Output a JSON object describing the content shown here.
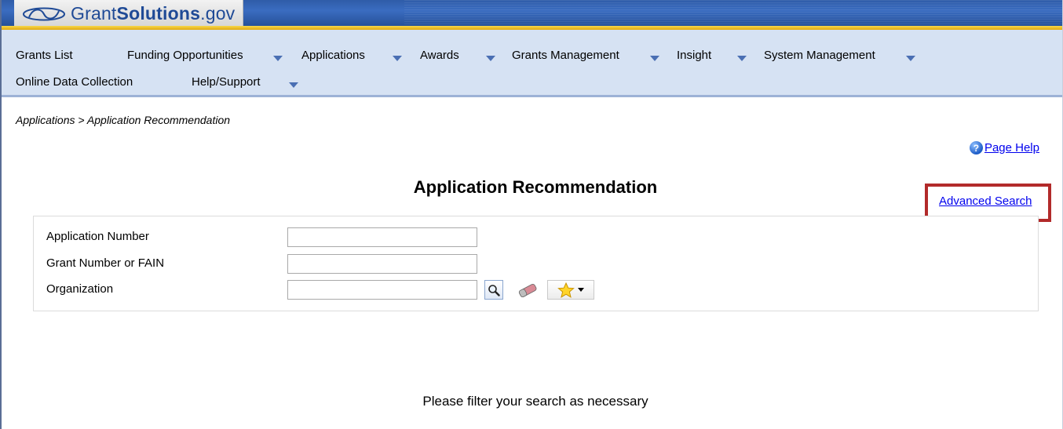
{
  "brand": {
    "prefix": "Grant",
    "strong": "Solutions",
    "suffix": ".gov"
  },
  "nav": {
    "items": [
      {
        "label": "Grants List",
        "has_menu": false
      },
      {
        "label": "Funding Opportunities",
        "has_menu": true
      },
      {
        "label": "Applications",
        "has_menu": true
      },
      {
        "label": "Awards",
        "has_menu": true
      },
      {
        "label": "Grants Management",
        "has_menu": true
      },
      {
        "label": "Insight",
        "has_menu": true
      },
      {
        "label": "System Management",
        "has_menu": true
      },
      {
        "label": "Online Data Collection",
        "has_menu": false
      },
      {
        "label": "Help/Support",
        "has_menu": true
      }
    ]
  },
  "breadcrumb": "Applications > Application Recommendation",
  "page_help": "Page Help",
  "page_title": "Application Recommendation",
  "advanced_search": "Advanced Search",
  "form": {
    "fields": [
      {
        "label": "Application Number",
        "value": ""
      },
      {
        "label": "Grant Number or FAIN",
        "value": ""
      },
      {
        "label": "Organization",
        "value": ""
      }
    ]
  },
  "message": "Please filter your search as necessary",
  "colors": {
    "header_blue": "#2f5ca8",
    "nav_bg": "#d6e2f3",
    "highlight": "#b22a2a",
    "link": "#0000ee"
  },
  "icons": [
    "grantsolutions-logo-icon",
    "help-icon",
    "magnifier-icon",
    "eraser-icon",
    "star-icon",
    "chevron-down-icon"
  ]
}
